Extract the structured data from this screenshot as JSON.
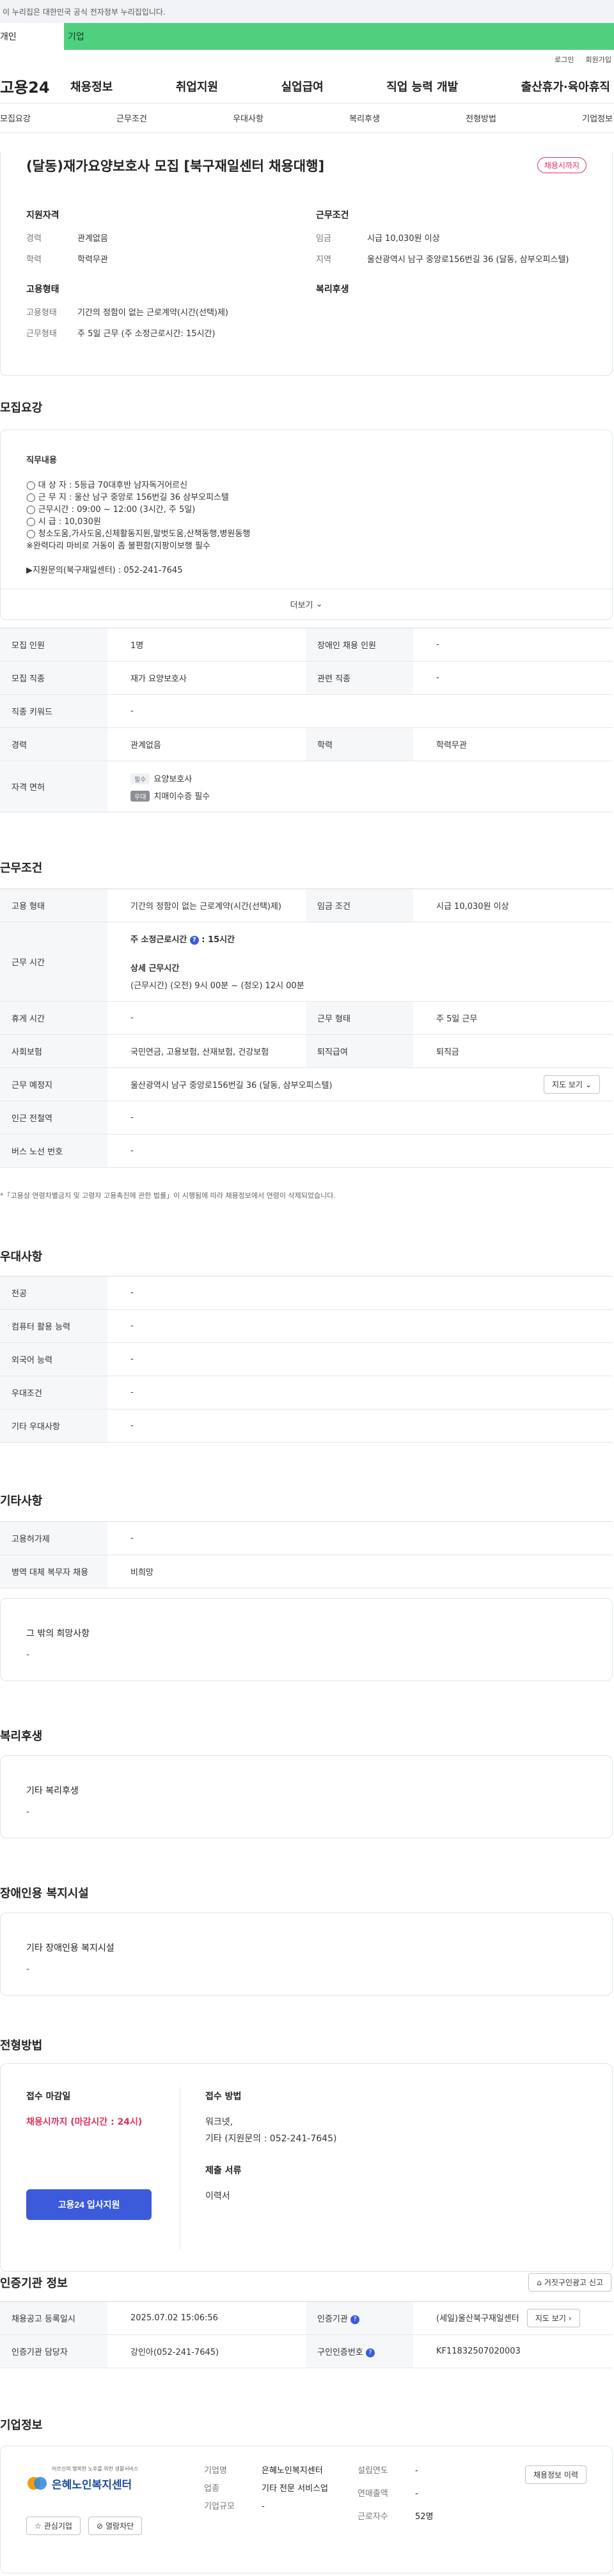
{
  "gov_bar": {
    "text": "이 누리집은 대한민국 공식 전자정부 누리집입니다."
  },
  "top_tabs": {
    "personal": "개인",
    "company": "기업"
  },
  "util": {
    "login": "로그인",
    "signup": "회원가입"
  },
  "logo": "고용24",
  "gnb": [
    "채용정보",
    "취업지원",
    "실업급여",
    "직업 능력 개발",
    "출산휴가·육아휴직"
  ],
  "subnav": [
    "모집요강",
    "근무조건",
    "우대사항",
    "복리후생",
    "전형방법",
    "기업정보"
  ],
  "summary": {
    "title": "(달동)재가요양보호사 모집 [북구재일센터 채용대행]",
    "status_badge": "채용시까지",
    "qualification_title": "지원자격",
    "work_title": "근무조건",
    "employment_title": "고용형태",
    "welfare_title": "복리후생",
    "rows_left": [
      {
        "k": "경력",
        "v": "관계없음"
      },
      {
        "k": "학력",
        "v": "학력무관"
      }
    ],
    "rows_right": [
      {
        "k": "임금",
        "v": "시급 10,030원 이상"
      },
      {
        "k": "지역",
        "v": "울산광역시 남구 중앙로156번길 36 (달동, 삼부오피스텔)"
      }
    ],
    "employment_rows": [
      {
        "k": "고용형태",
        "v": "기간의 정함이 없는 근로계약(시간(선택)제)"
      },
      {
        "k": "근무형태",
        "v": "주 5일 근무 (주 소정근로시간: 15시간)"
      }
    ]
  },
  "recruit_section": {
    "title": "모집요강",
    "job_desc_title": "직무내용",
    "job_desc_lines": [
      "◯ 대 상 자 : 5등급 70대후반 남자독거어르신",
      "◯ 근 무 지 : 울산 남구 중앙로 156번길 36 삼부오피스텔",
      "◯ 근무시간 : 09:00 ~ 12:00 (3시간, 주 5일)",
      "◯ 시        급 : 10,030원",
      "◯ 청소도움,가사도움,신체활동지원,말벗도움,산책동행,병원동행",
      "※완력다리 마비로 거동이 좀 불편함(지팡이보행 필수",
      "",
      "▶지원문의(북구재일센터) : 052-241-7645"
    ],
    "more": "더보기",
    "table": {
      "headcount_k": "모집 인원",
      "headcount_v": "1명",
      "disabled_k": "장애인 채용 인원",
      "disabled_v": "-",
      "occupation_k": "모집 직종",
      "occupation_v": "재가 요양보호사",
      "related_k": "관련 직종",
      "related_v": "-",
      "keyword_k": "직종 키워드",
      "keyword_v": "-",
      "career_k": "경력",
      "career_v": "관계없음",
      "edu_k": "학력",
      "edu_v": "학력무관",
      "license_k": "자격 면허",
      "license_1_tag": "필수",
      "license_1": "요양보호사",
      "license_2_tag": "우대",
      "license_2": "치매이수증 필수"
    }
  },
  "work_section": {
    "title": "근무조건",
    "emp_type_k": "고용 형태",
    "emp_type_v": "기간의 정함이 없는 근로계약(시간(선택)제)",
    "wage_k": "임금 조건",
    "wage_v": "시급 10,030원 이상",
    "hours_k": "근무 시간",
    "weekly_label": "주 소정근로시간",
    "weekly_v": "15시간",
    "detail_label": "상세 근무시간",
    "detail_v": "(근무시간) (오전) 9시 00분 ~ (정오) 12시 00분",
    "rest_k": "휴게 시간",
    "rest_v": "-",
    "work_form_k": "근무 형태",
    "work_form_v": "주 5일 근무",
    "insurance_k": "사회보험",
    "insurance_v": "국민연금, 고용보험, 산재보험, 건강보험",
    "retire_k": "퇴직급여",
    "retire_v": "퇴직금",
    "location_k": "근무 예정지",
    "location_v": "울산광역시 남구 중앙로156번길 36 (달동, 삼부오피스텔)",
    "map_btn": "지도 보기",
    "subway_k": "인근 전철역",
    "subway_v": "-",
    "bus_k": "버스 노선 번호",
    "bus_v": "-",
    "note": "*「고용상 연령차별금지 및 고령자 고용촉진에 관한 법률」이 시행됨에 따라 채용정보에서 연령이 삭제되었습니다."
  },
  "pref_section": {
    "title": "우대사항",
    "rows": [
      {
        "k": "전공",
        "v": "-"
      },
      {
        "k": "컴퓨터 활용 능력",
        "v": "-"
      },
      {
        "k": "외국어 능력",
        "v": "-"
      },
      {
        "k": "우대조건",
        "v": "-"
      },
      {
        "k": "기타 우대사항",
        "v": "-"
      }
    ]
  },
  "etc_section": {
    "title": "기타사항",
    "rows": [
      {
        "k": "고용허가제",
        "v": "-"
      },
      {
        "k": "병역 대체 복무자 채용",
        "v": "비희망"
      }
    ],
    "other_title": "그 밖의 희망사항",
    "other_v": "-"
  },
  "welfare_section": {
    "title": "복리후생",
    "sub": "기타 복리후생",
    "v": "-"
  },
  "disabled_section": {
    "title": "장애인용 복지시설",
    "sub": "기타 장애인용 복지시설",
    "v": "-"
  },
  "apply_section": {
    "title": "전형방법",
    "deadline_label": "접수 마감일",
    "deadline_v": "채용시까지 (마감시간 : 24시)",
    "apply_btn": "고용24 입사지원",
    "method_label": "접수 방법",
    "method_lines": [
      "워크넷,",
      "기타 (지원문의 : 052-241-7645)"
    ],
    "docs_label": "제출 서류",
    "docs_v": "이력서"
  },
  "cert_section": {
    "title": "인증기관 정보",
    "report_btn": "거짓구인광고 신고",
    "reg_date_k": "채용공고 등록일시",
    "reg_date_v": "2025.07.02 15:06:56",
    "org_k": "인증기관",
    "org_v": "(세일)울산북구재일센터",
    "map_btn": "지도 보기",
    "manager_k": "인증기관 담당자",
    "manager_v": "강인아(052-241-7645)",
    "job_no_k": "구인인증번호",
    "job_no_v": "KF11832507020003"
  },
  "company_section": {
    "title": "기업정보",
    "logo_tagline": "어르신의 행복한 노후를 위한 생활서비스",
    "logo_name": "은혜노인복지센터",
    "fav_btn": "관심기업",
    "block_btn": "열람차단",
    "name_k": "기업명",
    "name_v": "은혜노인복지센터",
    "industry_k": "업종",
    "industry_v": "기타 전문 서비스업",
    "size_k": "기업규모",
    "size_v": "-",
    "founded_k": "설립연도",
    "founded_v": "-",
    "revenue_k": "연매출액",
    "revenue_v": "-",
    "employees_k": "근로자수",
    "employees_v": "52명",
    "history_btn": "채용정보 이력"
  }
}
